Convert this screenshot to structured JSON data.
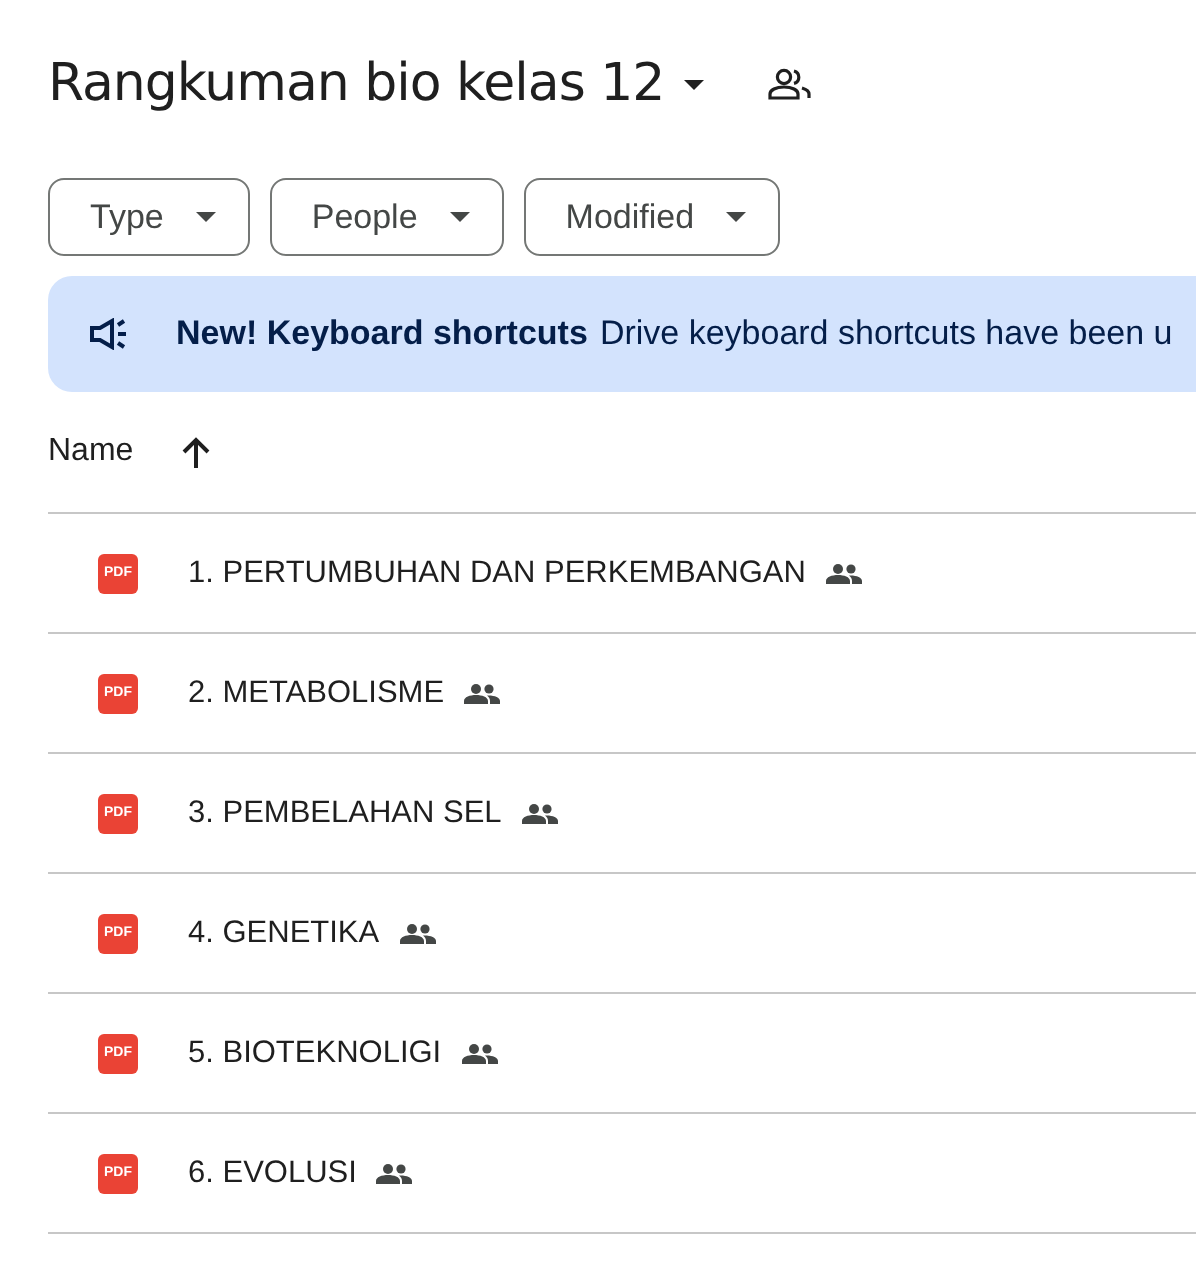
{
  "title": "Rangkuman bio kelas 12",
  "filters": [
    {
      "label": "Type"
    },
    {
      "label": "People"
    },
    {
      "label": "Modified"
    }
  ],
  "banner": {
    "heading": "New! Keyboard shortcuts",
    "text": "Drive keyboard shortcuts have been u"
  },
  "table": {
    "columns": [
      {
        "label": "Name",
        "sorted_ascending": true
      }
    ],
    "rows": [
      {
        "file_type": "PDF",
        "name": "1. PERTUMBUHAN DAN PERKEMBANGAN",
        "shared": true
      },
      {
        "file_type": "PDF",
        "name": "2. METABOLISME",
        "shared": true
      },
      {
        "file_type": "PDF",
        "name": "3. PEMBELAHAN SEL",
        "shared": true
      },
      {
        "file_type": "PDF",
        "name": "4. GENETIKA",
        "shared": true
      },
      {
        "file_type": "PDF",
        "name": "5. BIOTEKNOLIGI",
        "shared": true
      },
      {
        "file_type": "PDF",
        "name": "6. EVOLUSI",
        "shared": true
      }
    ]
  }
}
